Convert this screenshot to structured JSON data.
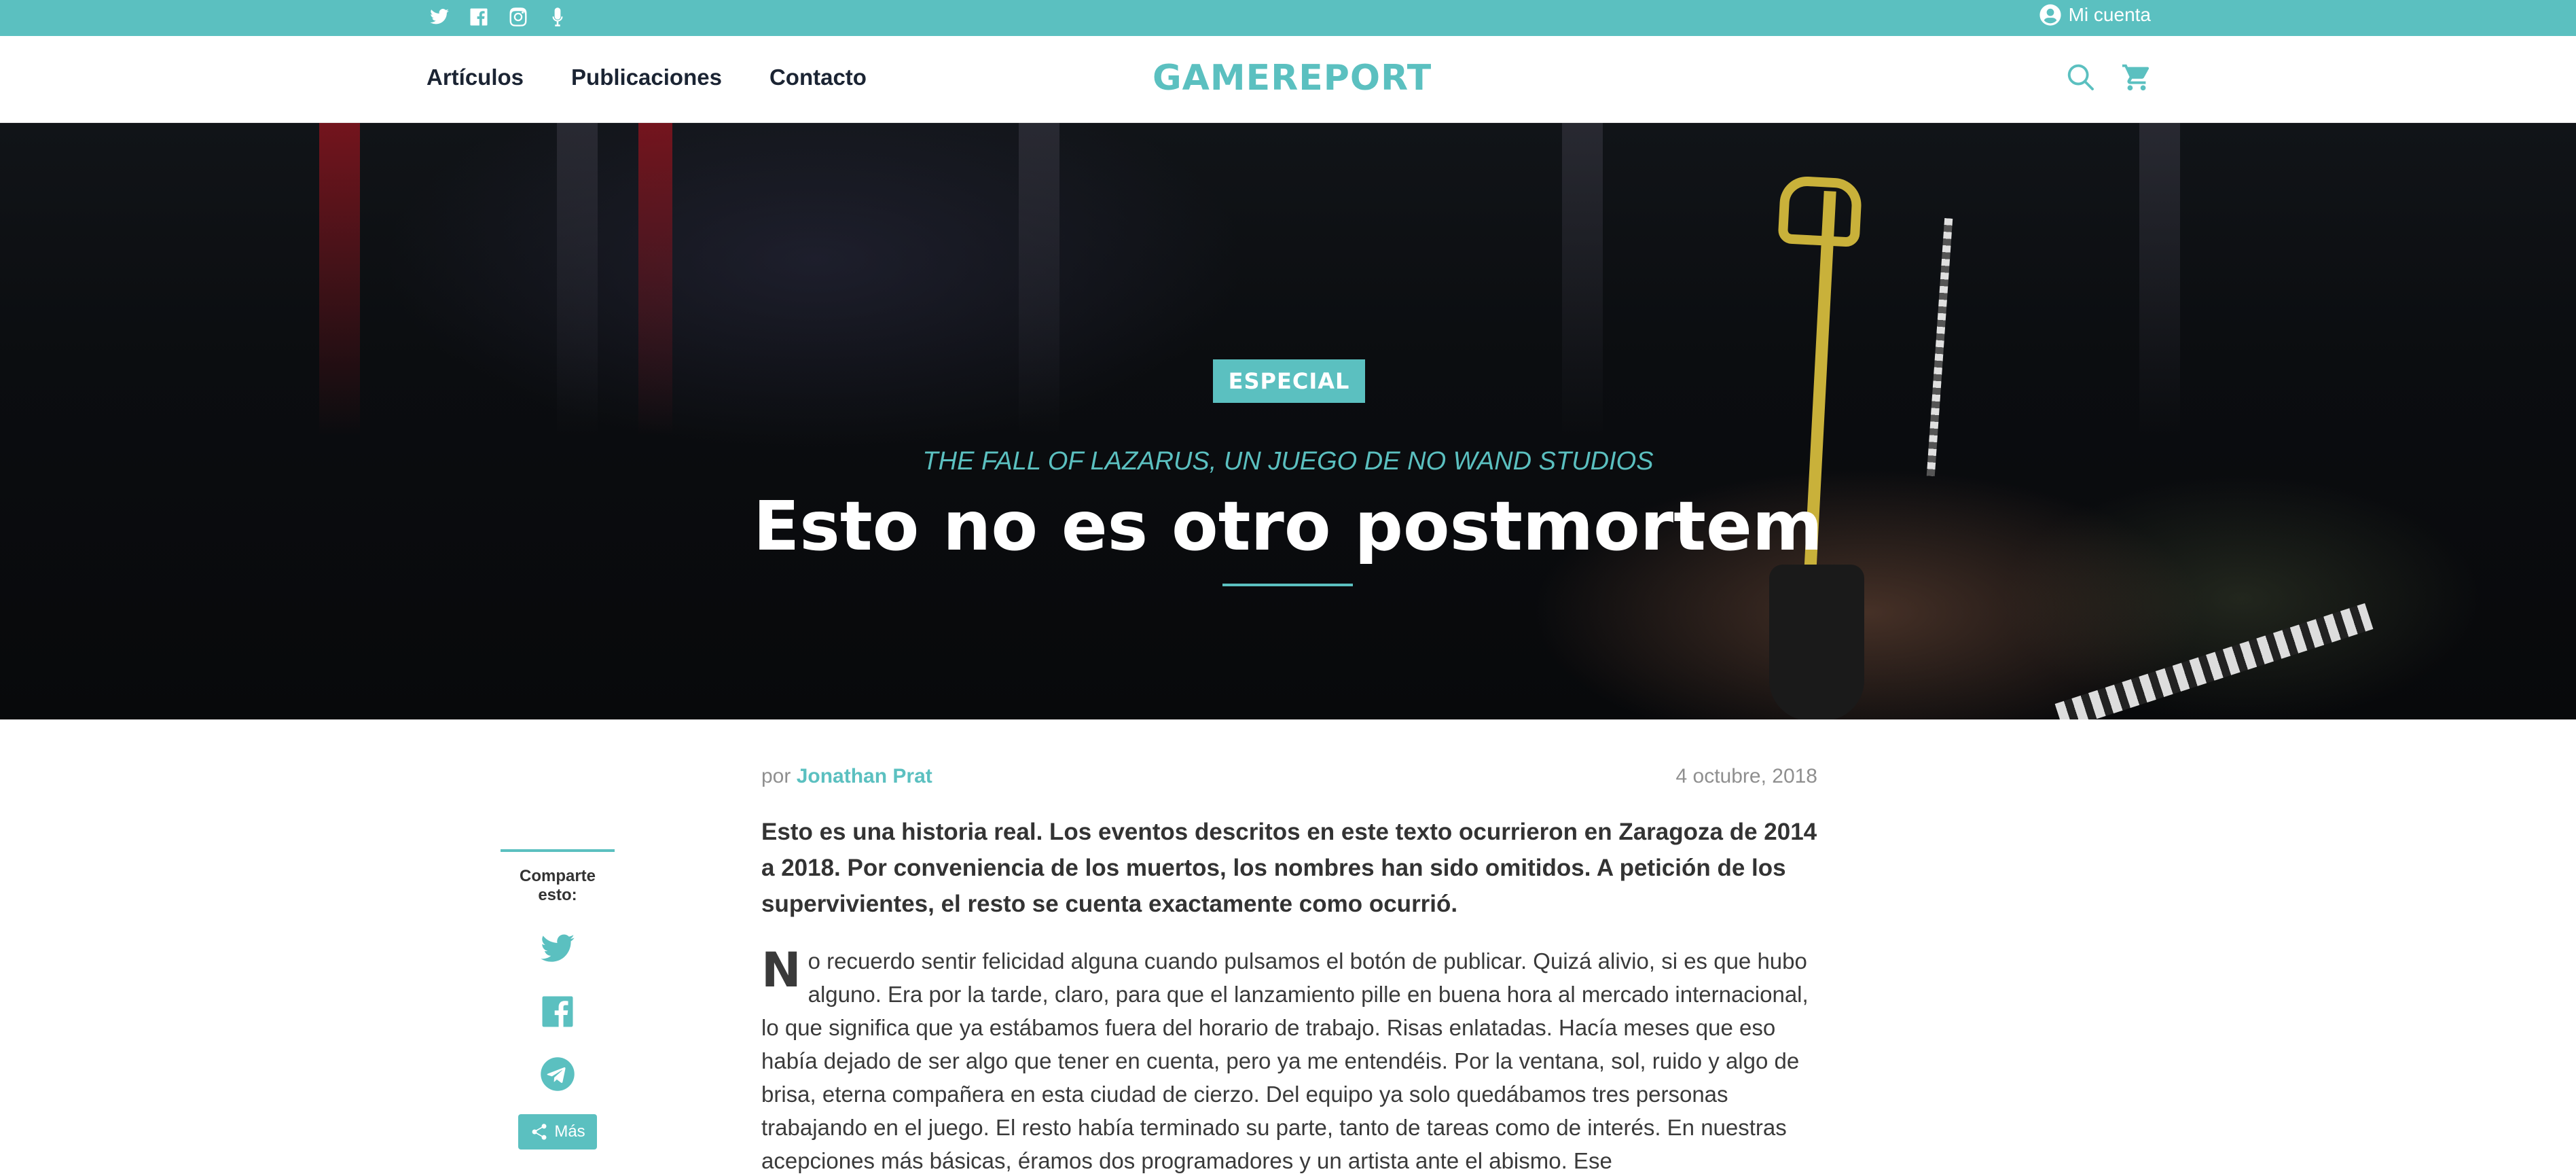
{
  "topbar": {
    "social_icons": [
      "twitter-icon",
      "facebook-icon",
      "instagram-icon",
      "microphone-icon"
    ],
    "account_label": "Mi cuenta"
  },
  "nav": {
    "items": [
      "Artículos",
      "Publicaciones",
      "Contacto"
    ],
    "logo": "GAMEREPORT"
  },
  "hero": {
    "badge": "ESPECIAL",
    "subtitle": "THE FALL OF LAZARUS, UN JUEGO DE NO WAND STUDIOS",
    "title": "Esto no es otro postmortem"
  },
  "article": {
    "by_prefix": "por",
    "author": "Jonathan Prat",
    "date": "4 octubre, 2018",
    "lead": "Esto es una historia real. Los eventos descritos en este texto ocurrieron en Zaragoza de 2014 a 2018. Por conveniencia de los muertos, los nombres han sido omitidos. A petición de los supervivientes, el resto se cuenta exactamente como ocurrió.",
    "dropcap": "N",
    "body": "o recuerdo sentir felicidad alguna cuando pulsamos el botón de publicar. Quizá alivio, si es que hubo alguno. Era por la tarde, claro, para que el lanzamiento pille en buena hora al mercado internacional, lo que significa que ya estábamos fuera del horario de trabajo. Risas enlatadas. Hacía meses que eso había dejado de ser algo que tener en cuenta, pero ya me entendéis. Por la ventana, sol, ruido y algo de brisa, eterna compañera en esta ciudad de cierzo. Del equipo ya solo quedábamos tres personas trabajando en el juego. El resto había terminado su parte, tanto de tareas como de interés. En nuestras acepciones más básicas, éramos dos programadores y un artista ante el abismo. Ese"
  },
  "share": {
    "label": "Comparte esto:",
    "more_label": "Más"
  },
  "colors": {
    "accent": "#5bc0c0",
    "nav_text": "#1b2433",
    "body_text": "#3a3a3a",
    "meta_text": "#8f8f8f"
  }
}
